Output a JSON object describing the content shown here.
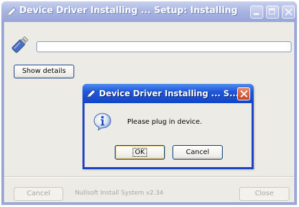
{
  "main_window": {
    "title": "Device Driver Installing ... Setup: Installing",
    "show_details_label": "Show details",
    "cancel_label": "Cancel",
    "close_label": "Close",
    "branding": "Nullsoft Install System v2.34",
    "progress": 0
  },
  "dialog": {
    "title": "Device Driver Installing ... S...",
    "message": "Please plug in device.",
    "ok_label": "OK",
    "cancel_label": "Cancel",
    "icon": "info-icon"
  },
  "colors": {
    "inactive_titlebar": "#a9b5e1",
    "active_titlebar": "#1f57d8",
    "window_body": "#ecebe6",
    "close_button": "#c8431d"
  }
}
